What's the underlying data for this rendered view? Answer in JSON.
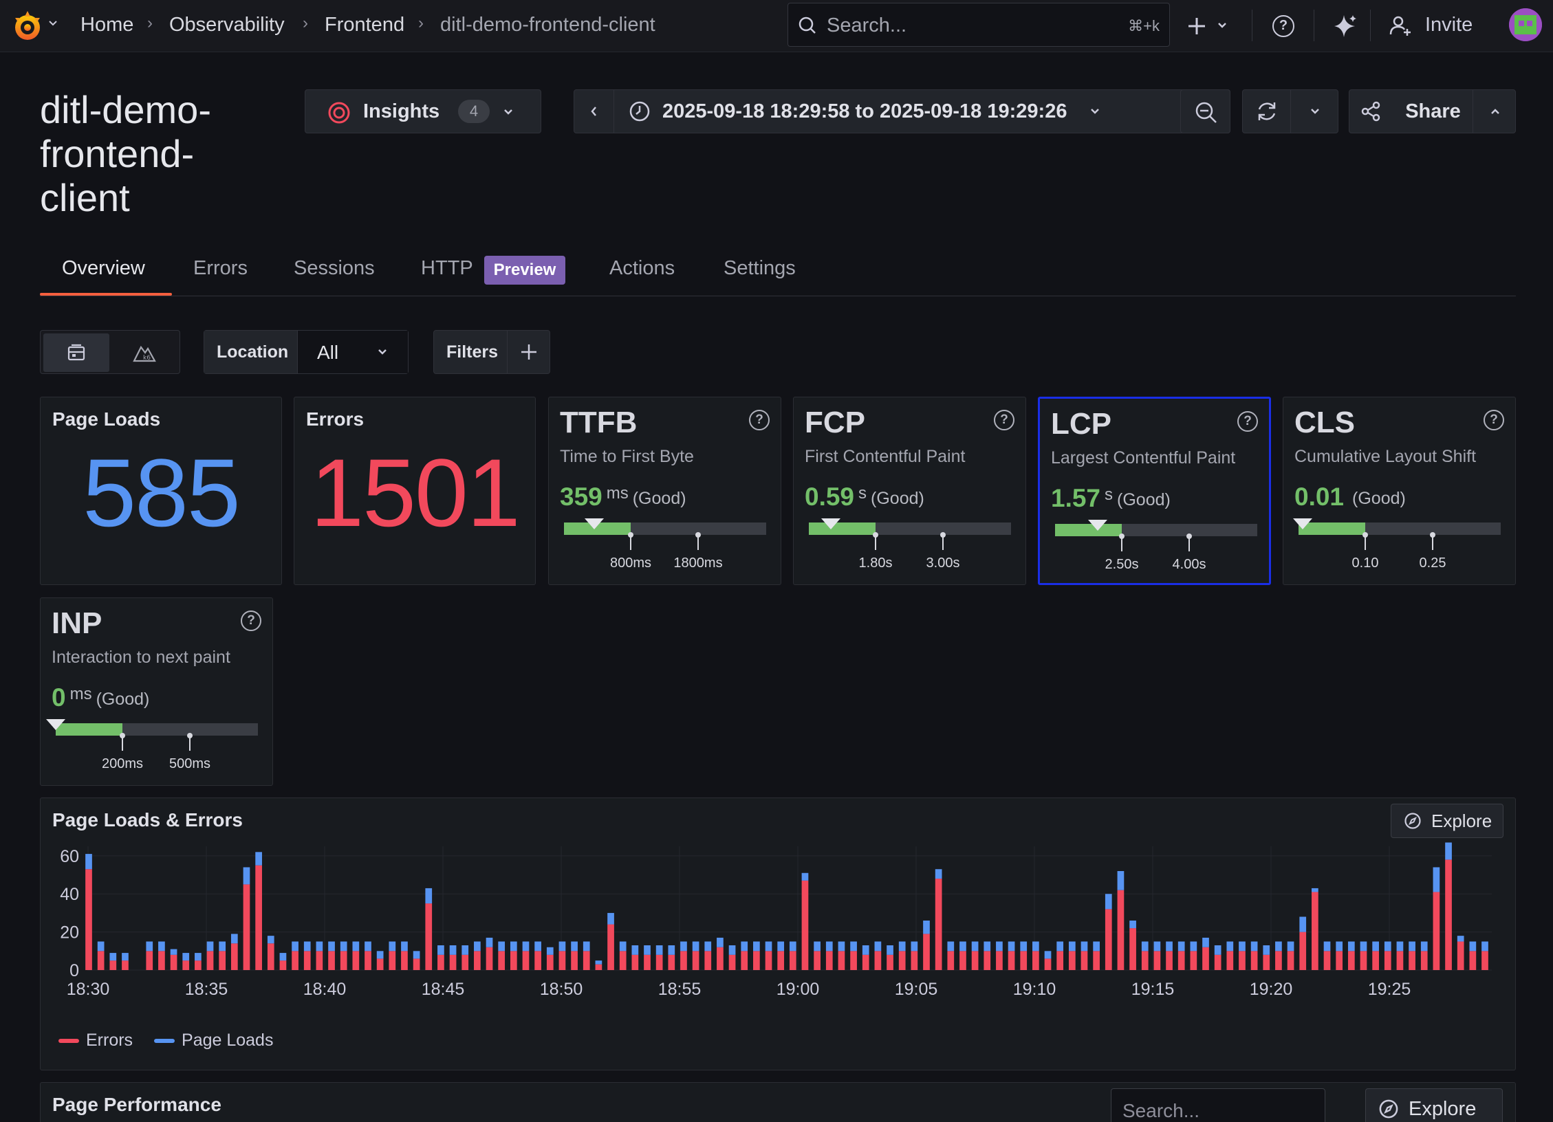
{
  "topbar": {
    "breadcrumbs": [
      "Home",
      "Observability",
      "Frontend",
      "ditl-demo-frontend-client"
    ],
    "search_placeholder": "Search...",
    "search_shortcut": "⌘+k",
    "invite_label": "Invite"
  },
  "header": {
    "title": "ditl-demo-frontend-client",
    "title_lines": [
      "ditl-demo-",
      "frontend-",
      "client"
    ],
    "insights_label": "Insights",
    "insights_count": "4",
    "time_range": "2025-09-18 18:29:58 to 2025-09-18 19:29:26",
    "share_label": "Share"
  },
  "tabs": [
    {
      "label": "Overview",
      "active": true
    },
    {
      "label": "Errors"
    },
    {
      "label": "Sessions"
    },
    {
      "label": "HTTP",
      "badge": "Preview"
    },
    {
      "label": "Actions"
    },
    {
      "label": "Settings"
    }
  ],
  "filters": {
    "location_label": "Location",
    "location_value": "All",
    "filters_label": "Filters"
  },
  "stats": {
    "page_loads": {
      "title": "Page Loads",
      "value": "585",
      "color": "#5794f2"
    },
    "errors": {
      "title": "Errors",
      "value": "1501",
      "color": "#f2495c"
    }
  },
  "vitals": [
    {
      "key": "ttfb",
      "title": "TTFB",
      "subtitle": "Time to First Byte",
      "value": "359",
      "unit": "ms",
      "rating": "(Good)",
      "thresholds": [
        "800ms",
        "1800ms"
      ],
      "fill": 0.33,
      "marker": 0.15
    },
    {
      "key": "fcp",
      "title": "FCP",
      "subtitle": "First Contentful Paint",
      "value": "0.59",
      "unit": "s",
      "rating": "(Good)",
      "thresholds": [
        "1.80s",
        "3.00s"
      ],
      "fill": 0.33,
      "marker": 0.11
    },
    {
      "key": "lcp",
      "title": "LCP",
      "subtitle": "Largest Contentful Paint",
      "value": "1.57",
      "unit": "s",
      "rating": "(Good)",
      "thresholds": [
        "2.50s",
        "4.00s"
      ],
      "fill": 0.33,
      "marker": 0.21
    },
    {
      "key": "cls",
      "title": "CLS",
      "subtitle": "Cumulative Layout Shift",
      "value": "0.01",
      "unit": "",
      "rating": "(Good)",
      "thresholds": [
        "0.10",
        "0.25"
      ],
      "fill": 0.33,
      "marker": 0.02
    },
    {
      "key": "inp",
      "title": "INP",
      "subtitle": "Interaction to next paint",
      "value": "0",
      "unit": "ms",
      "rating": "(Good)",
      "thresholds": [
        "200ms",
        "500ms"
      ],
      "fill": 0.33,
      "marker": 0.0
    }
  ],
  "chart_panel": {
    "title": "Page Loads & Errors",
    "explore_label": "Explore"
  },
  "chart_data": {
    "type": "bar",
    "stacked": true,
    "ylim": [
      0,
      65
    ],
    "yticks": [
      "0",
      "20",
      "40",
      "60"
    ],
    "xticks": [
      "18:30",
      "18:35",
      "18:40",
      "18:45",
      "18:50",
      "18:55",
      "19:00",
      "19:05",
      "19:10",
      "19:15",
      "19:20",
      "19:25"
    ],
    "legend": [
      "Errors",
      "Page Loads"
    ],
    "colors": {
      "errors": "#f2495c",
      "page_loads": "#5794f2"
    },
    "series": [
      {
        "name": "Errors",
        "values": [
          53,
          10,
          5,
          5,
          0,
          10,
          10,
          8,
          5,
          5,
          10,
          10,
          14,
          45,
          55,
          14,
          5,
          10,
          10,
          10,
          10,
          10,
          10,
          10,
          6,
          10,
          10,
          6,
          35,
          8,
          8,
          8,
          10,
          12,
          10,
          10,
          10,
          10,
          8,
          10,
          10,
          10,
          3,
          24,
          10,
          8,
          8,
          8,
          8,
          10,
          10,
          10,
          12,
          8,
          10,
          10,
          10,
          10,
          10,
          47,
          10,
          10,
          10,
          10,
          8,
          10,
          8,
          10,
          10,
          19,
          48,
          10,
          10,
          10,
          10,
          10,
          10,
          10,
          10,
          6,
          10,
          10,
          10,
          10,
          32,
          42,
          22,
          10,
          10,
          10,
          10,
          10,
          12,
          8,
          10,
          10,
          10,
          8,
          10,
          10,
          20,
          41,
          10,
          10,
          10,
          10,
          10,
          10,
          10,
          10,
          10,
          41,
          58,
          15,
          10,
          10
        ]
      },
      {
        "name": "Page Loads",
        "values": [
          8,
          5,
          4,
          4,
          0,
          5,
          5,
          3,
          4,
          4,
          5,
          5,
          5,
          9,
          7,
          4,
          4,
          5,
          5,
          5,
          5,
          5,
          5,
          5,
          4,
          5,
          5,
          4,
          8,
          5,
          5,
          5,
          5,
          5,
          5,
          5,
          5,
          5,
          4,
          5,
          5,
          5,
          2,
          6,
          5,
          5,
          5,
          5,
          5,
          5,
          5,
          5,
          5,
          5,
          5,
          5,
          5,
          5,
          5,
          4,
          5,
          5,
          5,
          5,
          5,
          5,
          5,
          5,
          5,
          7,
          5,
          5,
          5,
          5,
          5,
          5,
          5,
          5,
          5,
          4,
          5,
          5,
          5,
          5,
          8,
          10,
          4,
          5,
          5,
          5,
          5,
          5,
          5,
          5,
          5,
          5,
          5,
          5,
          5,
          5,
          8,
          2,
          5,
          5,
          5,
          5,
          5,
          5,
          5,
          5,
          5,
          13,
          9,
          3,
          5,
          5
        ]
      }
    ]
  },
  "bottom_panel": {
    "title": "Page Performance",
    "search_placeholder": "Search...",
    "explore_label": "Explore"
  }
}
